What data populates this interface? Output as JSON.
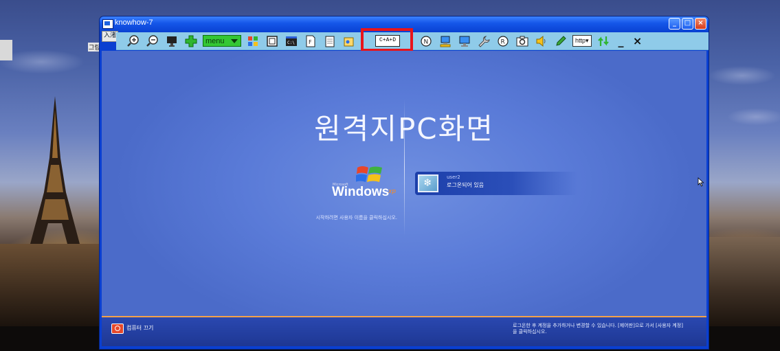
{
  "window": {
    "title": "knowhow-7",
    "ime_indicator": "入渚",
    "minimize": "_",
    "maximize": "□",
    "close": "×"
  },
  "host": {
    "desktop_label": "그림"
  },
  "toolbar": {
    "tools": [
      {
        "icon": "zoom-in-icon"
      },
      {
        "icon": "zoom-out-icon"
      },
      {
        "icon": "monitor-icon"
      },
      {
        "icon": "plus-icon"
      },
      {
        "icon": "menu-dropdown",
        "label": "menu"
      },
      {
        "icon": "windows-flag-icon"
      },
      {
        "icon": "window-frame-icon"
      },
      {
        "icon": "command-prompt-icon"
      },
      {
        "icon": "document-f-icon"
      },
      {
        "icon": "notepad-icon"
      },
      {
        "icon": "paint-icon"
      },
      {
        "icon": "ctrl-alt-del-button",
        "label": "C+A+D"
      },
      {
        "icon": "n-circle-icon"
      },
      {
        "icon": "network-computer-icon"
      },
      {
        "icon": "desktop-computer-icon"
      },
      {
        "icon": "wrench-icon"
      },
      {
        "icon": "r-circle-icon"
      },
      {
        "icon": "camera-icon"
      },
      {
        "icon": "speaker-icon"
      },
      {
        "icon": "pencil-icon"
      },
      {
        "icon": "http-dropdown",
        "label": "http"
      },
      {
        "icon": "refresh-arrows-icon"
      },
      {
        "icon": "minimize-icon",
        "label": "_"
      },
      {
        "icon": "close-icon",
        "label": "×"
      }
    ],
    "menu_label": "menu",
    "cad_label": "C+A+D",
    "http_label": "http▾",
    "min_label": "_",
    "close_label": "×"
  },
  "remote": {
    "title": "원격지PC화면",
    "brand_small": "Microsoft",
    "brand": "Windows",
    "brand_suffix": "xp",
    "hint": "시작하려면 사용자 이름을 클릭하십시오.",
    "user": {
      "name": "user2",
      "status": "로그온되어 있음"
    },
    "power_label": "컴퓨터 끄기",
    "bottom_note": "로그온한 후 계정을 추가하거나 변경할 수 있습니다. [제어판]으로 가서 [사용자 계정]을 클릭하십시오."
  },
  "colors": {
    "toolbar_bg": "#8fcbe9",
    "title_bar": "#1556e8",
    "highlight": "#e8141a",
    "screen_bg": "#5a7bd8"
  }
}
